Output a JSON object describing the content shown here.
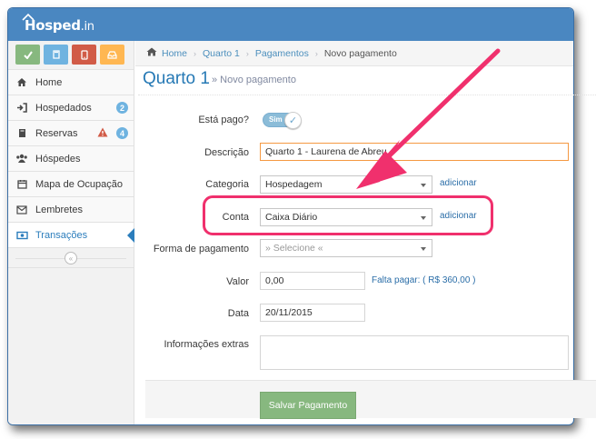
{
  "app": {
    "logo": "Hosped",
    "logo_suffix": ".in"
  },
  "quick_buttons": [
    {
      "icon": "check-icon",
      "color": "#87b87f"
    },
    {
      "icon": "book-icon",
      "color": "#6fb3e0"
    },
    {
      "icon": "phone-icon",
      "color": "#d15b47"
    },
    {
      "icon": "inbox-icon",
      "color": "#ffb752"
    }
  ],
  "sidebar": {
    "items": [
      {
        "label": "Home",
        "icon": "home-icon"
      },
      {
        "label": "Hospedados",
        "icon": "sign-in-icon",
        "badge": "2"
      },
      {
        "label": "Reservas",
        "icon": "book-icon",
        "badge": "4",
        "warning": true
      },
      {
        "label": "Hóspedes",
        "icon": "users-icon"
      },
      {
        "label": "Mapa de Ocupação",
        "icon": "calendar-icon"
      },
      {
        "label": "Lembretes",
        "icon": "envelope-icon"
      },
      {
        "label": "Transações",
        "icon": "money-icon",
        "active": true
      }
    ],
    "collapse_icon": "double-chevron-left-icon"
  },
  "breadcrumb": {
    "items": [
      "Home",
      "Quarto 1",
      "Pagamentos"
    ],
    "current": "Novo pagamento"
  },
  "page": {
    "title": "Quarto 1",
    "subtitle": "» Novo pagamento"
  },
  "form": {
    "pago_label": "Está pago?",
    "pago_value": "Sim",
    "descricao_label": "Descrição",
    "descricao_value": "Quarto 1 - Laurena de Abreu",
    "categoria_label": "Categoria",
    "categoria_value": "Hospedagem",
    "categoria_add": "adicionar",
    "conta_label": "Conta",
    "conta_value": "Caixa Diário",
    "conta_add": "adicionar",
    "forma_label": "Forma de pagamento",
    "forma_value": "» Selecione «",
    "valor_label": "Valor",
    "valor_value": "0,00",
    "falta_pagar": "Falta pagar: ( R$ 360,00 )",
    "data_label": "Data",
    "data_value": "20/11/2015",
    "info_label": "Informações extras",
    "info_value": "",
    "save_label": "Salvar Pagamento"
  },
  "colors": {
    "brand": "#4a87c1",
    "link": "#2b6ea8",
    "annotation": "#f0306d",
    "save": "#87b87f"
  }
}
